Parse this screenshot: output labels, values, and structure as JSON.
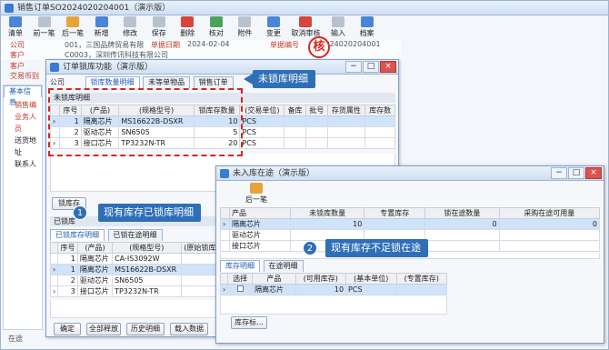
{
  "main_window": {
    "title": "销售订单SO2024020204001（演示版）",
    "toolbar": [
      {
        "label": "清单",
        "icon": "list-icon"
      },
      {
        "label": "前一笔",
        "icon": "prev-icon"
      },
      {
        "label": "后一笔",
        "icon": "next-icon"
      },
      {
        "label": "新增",
        "icon": "new-icon"
      },
      {
        "label": "修改",
        "icon": "edit-icon"
      },
      {
        "label": "保存",
        "icon": "save-icon"
      },
      {
        "label": "删除",
        "icon": "delete-icon"
      },
      {
        "label": "核对",
        "icon": "check-icon"
      },
      {
        "label": "附件",
        "icon": "attachment-icon"
      },
      {
        "label": "变更",
        "icon": "change-icon"
      },
      {
        "label": "取消审核",
        "icon": "unaudit-icon"
      },
      {
        "label": "输入",
        "icon": "input-icon"
      },
      {
        "label": "档案",
        "icon": "archive-icon"
      }
    ],
    "fields": {
      "company_label": "公司",
      "company_value": "001，三国品牌贸易有限",
      "unit_date_label": "单据日期",
      "unit_date_value": "2024-02-04",
      "order_no_label": "单据编号",
      "order_no_value": "SO2024020204001",
      "customer_label": "客户",
      "customer_value": "C0003，深圳传讯科技有限公司",
      "trade_label": "交易币别",
      "stamp_text": "核"
    },
    "left_tabs": [
      "基本信息",
      "销售编",
      "业务人员",
      "送货地址",
      "联系人"
    ],
    "left_labels": [
      "客户",
      "交易币别"
    ],
    "bottom_status": "在途"
  },
  "lock_window": {
    "title": "订单锁库功能（演示版）",
    "company_label": "公司",
    "tabs": [
      "锁库数量明细",
      "未等单物品",
      "销售订单"
    ],
    "section_label": "未锁库明细",
    "columns": [
      "序号",
      "(产品)",
      "(规格型号)",
      "锁库存数量",
      "(交易单位)",
      "备库",
      "批号",
      "存货属性",
      "库存数"
    ],
    "rows": [
      {
        "no": "1",
        "name": "隔离芯片",
        "spec": "MS16622B-DSXR",
        "qty": "10",
        "unit": "PCS"
      },
      {
        "no": "2",
        "name": "驱动芯片",
        "spec": "SN6505",
        "qty": "5",
        "unit": "PCS"
      },
      {
        "no": "3",
        "name": "接口芯片",
        "spec": "TP3232N-TR",
        "qty": "20",
        "unit": "PCS"
      }
    ],
    "lock_button": "锁库存",
    "locked_section_label": "已锁库",
    "locked_tabs": [
      "已锁库存明细",
      "已锁在途明细"
    ],
    "locked_columns": [
      "序号",
      "(产品)",
      "(规格型号)",
      "(原始锁库"
    ],
    "locked_rows": [
      {
        "no": "1",
        "name": "隔离芯片",
        "spec": "CA-IS3092W"
      },
      {
        "no": "1",
        "name": "隔离芯片",
        "spec": "MS16622B-DSXR"
      },
      {
        "no": "2",
        "name": "驱动芯片",
        "spec": "SN6505"
      },
      {
        "no": "3",
        "name": "接口芯片",
        "spec": "TP3232N-TR"
      }
    ],
    "footer_buttons": [
      "确定",
      "全部释放",
      "历史明细",
      "载入数据"
    ]
  },
  "transit_window": {
    "title": "未入库在途（演示版）",
    "toolbar": [
      {
        "label": "后一笔",
        "icon": "next-icon"
      }
    ],
    "columns": [
      "产品",
      "未锁库数量",
      "专置库存",
      "锁在途数量",
      "采购在途可用量"
    ],
    "rows": [
      {
        "name": "隔离芯片",
        "unlocked": "10",
        "reserved": "",
        "locked": "0",
        "available": "0"
      },
      {
        "name": "驱动芯片",
        "unlocked": "",
        "reserved": "",
        "locked": "",
        "available": ""
      },
      {
        "name": "接口芯片",
        "unlocked": "",
        "reserved": "",
        "locked": "",
        "available": ""
      }
    ],
    "subtabs": [
      "库存明细",
      "在途明细"
    ],
    "stock_columns": [
      "选择",
      "产品",
      "(可用库存)",
      "(基本单位)",
      "(专置库存)"
    ],
    "stock_rows": [
      {
        "name": "隔离芯片",
        "available": "10",
        "unit": "PCS"
      }
    ],
    "stock_button": "库存标..."
  },
  "callouts": {
    "top": "未锁库明细",
    "num1": "1",
    "text1": "现有库存已锁库明细",
    "num2": "2",
    "text2": "现有库存不足锁在途"
  },
  "colors": {
    "accent": "#2f6fb8",
    "dashed_border": "#d9251d",
    "selected_row": "#cfe3fb"
  }
}
